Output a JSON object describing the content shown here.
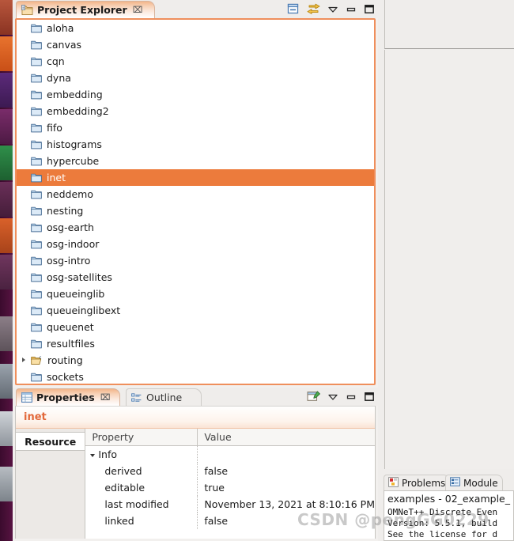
{
  "launcher": {
    "name": "ubuntu-unity-launcher",
    "background_color": "#4a1038",
    "icons": [
      "launcher-icon-1",
      "launcher-icon-2",
      "launcher-icon-3",
      "launcher-icon-4",
      "launcher-icon-5",
      "launcher-icon-6",
      "launcher-icon-7",
      "launcher-icon-8",
      "launcher-icon-9",
      "launcher-icon-10",
      "launcher-icon-11",
      "launcher-icon-12"
    ]
  },
  "project_explorer": {
    "tab_label": "Project Explorer",
    "tab_icon": "project-explorer-icon",
    "close_label": "⌧",
    "toolbar": [
      {
        "name": "collapse-all-icon",
        "title": "Collapse All"
      },
      {
        "name": "link-with-editor-icon",
        "title": "Link with Editor"
      },
      {
        "name": "view-menu-icon",
        "title": "View Menu"
      },
      {
        "name": "minimize-icon",
        "title": "Minimize"
      },
      {
        "name": "maximize-icon",
        "title": "Maximize"
      }
    ],
    "selection_color": "#ec7b3c",
    "border_color": "#ef8f5c",
    "items": [
      {
        "label": "aloha",
        "icon": "folder-icon",
        "expandable": false,
        "selected": false
      },
      {
        "label": "canvas",
        "icon": "folder-icon",
        "expandable": false,
        "selected": false
      },
      {
        "label": "cqn",
        "icon": "folder-icon",
        "expandable": false,
        "selected": false
      },
      {
        "label": "dyna",
        "icon": "folder-icon",
        "expandable": false,
        "selected": false
      },
      {
        "label": "embedding",
        "icon": "folder-icon",
        "expandable": false,
        "selected": false
      },
      {
        "label": "embedding2",
        "icon": "folder-icon",
        "expandable": false,
        "selected": false
      },
      {
        "label": "fifo",
        "icon": "folder-icon",
        "expandable": false,
        "selected": false
      },
      {
        "label": "histograms",
        "icon": "folder-icon",
        "expandable": false,
        "selected": false
      },
      {
        "label": "hypercube",
        "icon": "folder-icon",
        "expandable": false,
        "selected": false
      },
      {
        "label": "inet",
        "icon": "folder-icon",
        "expandable": false,
        "selected": true
      },
      {
        "label": "neddemo",
        "icon": "folder-icon",
        "expandable": false,
        "selected": false
      },
      {
        "label": "nesting",
        "icon": "folder-icon",
        "expandable": false,
        "selected": false
      },
      {
        "label": "osg-earth",
        "icon": "folder-icon",
        "expandable": false,
        "selected": false
      },
      {
        "label": "osg-indoor",
        "icon": "folder-icon",
        "expandable": false,
        "selected": false
      },
      {
        "label": "osg-intro",
        "icon": "folder-icon",
        "expandable": false,
        "selected": false
      },
      {
        "label": "osg-satellites",
        "icon": "folder-icon",
        "expandable": false,
        "selected": false
      },
      {
        "label": "queueinglib",
        "icon": "folder-icon",
        "expandable": false,
        "selected": false
      },
      {
        "label": "queueinglibext",
        "icon": "folder-icon",
        "expandable": false,
        "selected": false
      },
      {
        "label": "queuenet",
        "icon": "folder-icon",
        "expandable": false,
        "selected": false
      },
      {
        "label": "resultfiles",
        "icon": "folder-icon",
        "expandable": false,
        "selected": false
      },
      {
        "label": "routing",
        "icon": "c-project-folder-icon",
        "expandable": true,
        "selected": false
      },
      {
        "label": "sockets",
        "icon": "folder-icon",
        "expandable": false,
        "selected": false
      }
    ]
  },
  "properties_view": {
    "tabs": [
      {
        "label": "Properties",
        "icon": "properties-icon",
        "active": true,
        "close_label": "⌧"
      },
      {
        "label": "Outline",
        "icon": "outline-icon",
        "active": false,
        "close_label": ""
      }
    ],
    "toolbar": [
      {
        "name": "new-property-icon",
        "title": "New Property"
      },
      {
        "name": "view-menu-icon",
        "title": "View Menu"
      },
      {
        "name": "minimize-icon",
        "title": "Minimize"
      },
      {
        "name": "maximize-icon",
        "title": "Maximize"
      }
    ],
    "title": "inet",
    "title_color": "#e2683a",
    "side_tabs": [
      {
        "label": "Resource",
        "active": true
      }
    ],
    "table": {
      "headers": [
        "Property",
        "Value"
      ],
      "rows": [
        {
          "property": "Info",
          "value": "",
          "group": true
        },
        {
          "property": "derived",
          "value": "false",
          "group": false
        },
        {
          "property": "editable",
          "value": "true",
          "group": false
        },
        {
          "property": "last modified",
          "value": "November 13, 2021 at 8:10:16 PM",
          "group": false
        },
        {
          "property": "linked",
          "value": "false",
          "group": false
        }
      ]
    }
  },
  "editor_area": {
    "name": "editor-area",
    "empty": true
  },
  "bottom_right": {
    "tabs": [
      {
        "label": "Problems",
        "icon": "problems-icon",
        "active": false
      },
      {
        "label": "Module",
        "icon": "module-icon",
        "active": false
      }
    ],
    "path_line": "examples - 02_example_",
    "console_lines": [
      "OMNeT++ Discrete Even",
      "Version: 5.5.1, build",
      "See the license for d"
    ]
  },
  "watermark": {
    "text": "CSDN @pengGG0229"
  }
}
